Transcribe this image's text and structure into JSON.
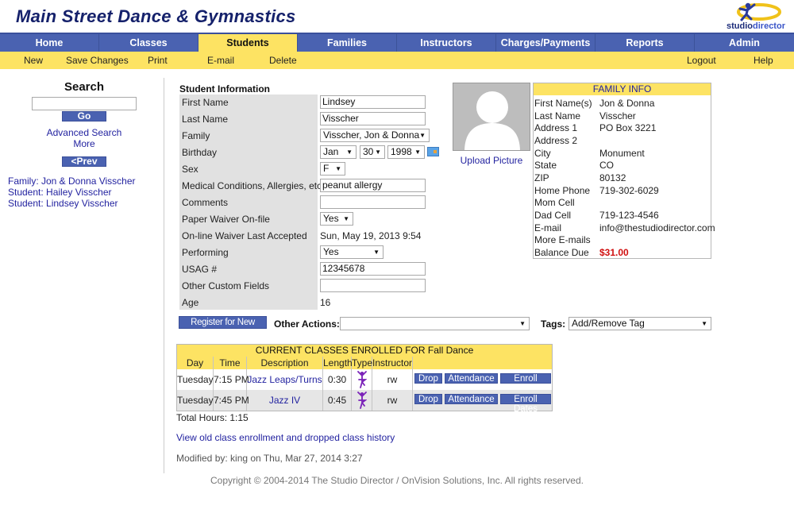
{
  "header": {
    "site_title": "Main Street Dance & Gymnastics",
    "logo_text_a": "studio",
    "logo_text_b": "director"
  },
  "nav": {
    "tabs": [
      {
        "label": "Home",
        "active": false
      },
      {
        "label": "Classes",
        "active": false
      },
      {
        "label": "Students",
        "active": true
      },
      {
        "label": "Families",
        "active": false
      },
      {
        "label": "Instructors",
        "active": false
      },
      {
        "label": "Charges/Payments",
        "active": false
      },
      {
        "label": "Reports",
        "active": false
      },
      {
        "label": "Admin",
        "active": false
      }
    ]
  },
  "subnav": {
    "new": "New",
    "save_changes": "Save Changes",
    "print": "Print",
    "email": "E-mail",
    "delete": "Delete",
    "logout": "Logout",
    "help": "Help"
  },
  "sidebar": {
    "search_title": "Search",
    "search_value": "",
    "go": "Go",
    "advanced_search": "Advanced Search",
    "more": "More",
    "prev": "<Prev",
    "recent": [
      "Family: Jon & Donna Visscher",
      "Student: Hailey Visscher",
      "Student: Lindsey Visscher"
    ]
  },
  "student": {
    "section_title": "Student Information",
    "labels": {
      "first_name": "First Name",
      "last_name": "Last Name",
      "family": "Family",
      "birthday": "Birthday",
      "sex": "Sex",
      "medical": "Medical Conditions, Allergies, etc",
      "comments": "Comments",
      "paper_waiver": "Paper Waiver On-file",
      "online_waiver": "On-line Waiver Last Accepted",
      "performing": "Performing",
      "usag": "USAG #",
      "other_custom": "Other Custom Fields",
      "age": "Age"
    },
    "values": {
      "first_name": "Lindsey",
      "last_name": "Visscher",
      "family": "Visscher, Jon & Donna",
      "birth_month": "Jan",
      "birth_day": "30",
      "birth_year": "1998",
      "sex": "F",
      "medical": "peanut allergy",
      "comments": "",
      "paper_waiver": "Yes",
      "online_waiver": "Sun, May 19, 2013 9:54",
      "performing": "Yes",
      "usag": "12345678",
      "other_custom": "",
      "age": "16"
    },
    "upload_picture": "Upload Picture"
  },
  "family_info": {
    "title": "FAMILY INFO",
    "rows": [
      {
        "label": "First Name(s)",
        "value": "Jon & Donna"
      },
      {
        "label": "Last Name",
        "value": "Visscher"
      },
      {
        "label": "Address 1",
        "value": "PO Box 3221"
      },
      {
        "label": "Address 2",
        "value": ""
      },
      {
        "label": "City",
        "value": "Monument"
      },
      {
        "label": "State",
        "value": "CO"
      },
      {
        "label": "ZIP",
        "value": "80132"
      },
      {
        "label": "Home Phone",
        "value": "719-302-6029"
      },
      {
        "label": "Mom Cell",
        "value": ""
      },
      {
        "label": "Dad Cell",
        "value": "719-123-4546"
      },
      {
        "label": "E-mail",
        "value": "info@thestudiodirector.com"
      },
      {
        "label": "More E-mails",
        "value": ""
      },
      {
        "label": "Balance Due",
        "value": "$31.00"
      }
    ],
    "balance_color": "#d01010"
  },
  "actions": {
    "register": "Register for New Class",
    "other_actions_label": "Other Actions:",
    "other_actions_value": "",
    "tags_label": "Tags:",
    "tags_value": "Add/Remove Tag"
  },
  "classes": {
    "title": "CURRENT CLASSES ENROLLED FOR Fall Dance",
    "headers": [
      "Day",
      "Time",
      "Description",
      "Length",
      "Type",
      "Instructor"
    ],
    "rows": [
      {
        "day": "Tuesday",
        "time": "7:15 PM",
        "description": "Jazz Leaps/Turns",
        "length": "0:30",
        "type": "dancer-icon",
        "instructor": "rw"
      },
      {
        "day": "Tuesday",
        "time": "7:45 PM",
        "description": "Jazz IV",
        "length": "0:45",
        "type": "dancer-icon",
        "instructor": "rw"
      }
    ],
    "buttons": {
      "drop": "Drop",
      "attendance": "Attendance",
      "enroll_dates": "Enroll Dates"
    },
    "total_hours": "Total Hours: 1:15"
  },
  "footer": {
    "history_link": "View old class enrollment and dropped class history",
    "modified": "Modified by: king on Thu, Mar 27, 2014 3:27",
    "copyright": "Copyright © 2004-2014 The Studio Director / OnVision Solutions, Inc. All rights reserved."
  },
  "colors": {
    "nav_blue": "#4a62b1",
    "accent_yellow": "#fde363",
    "title_navy": "#15216b",
    "link_blue": "#2323a0"
  }
}
